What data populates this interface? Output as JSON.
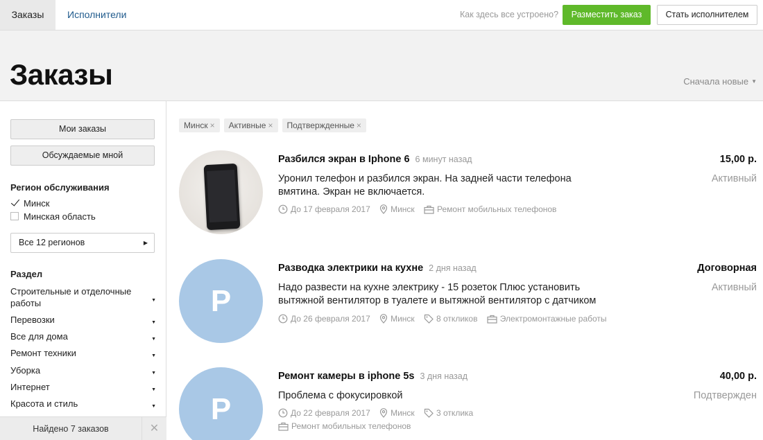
{
  "topbar": {
    "tab_orders": "Заказы",
    "tab_performers": "Исполнители",
    "how_link": "Как здесь все устроено?",
    "post_order": "Разместить заказ",
    "become_performer": "Стать исполнителем"
  },
  "header": {
    "title": "Заказы",
    "sort": "Сначала новые"
  },
  "sidebar": {
    "my_orders": "Мои заказы",
    "discussed": "Обсуждаемые мной",
    "region_heading": "Регион обслуживания",
    "regions": [
      {
        "label": "Минск",
        "checked": true
      },
      {
        "label": "Минская область",
        "checked": false
      }
    ],
    "all_regions": "Все 12 регионов",
    "section_heading": "Раздел",
    "categories": [
      "Строительные и отделочные работы",
      "Перевозки",
      "Все для дома",
      "Ремонт техники",
      "Уборка",
      "Интернет",
      "Красота и стиль"
    ],
    "found": "Найдено 7 заказов"
  },
  "filters": [
    "Минск",
    "Активные",
    "Подтвержденные"
  ],
  "orders": [
    {
      "title": "Разбился экран в Iphone 6",
      "time": "6 минут назад",
      "description": "Уронил телефон и разбился экран. На задней части телефона вмятина. Экран не включается.",
      "deadline": "До 17 февраля 2017",
      "city": "Минск",
      "category": "Ремонт мобильных телефонов",
      "price": "15,00 р.",
      "status": "Активный"
    },
    {
      "title": "Разводка электрики на кухне",
      "time": "2 дня назад",
      "avatar_letter": "Р",
      "description": "Надо развести на кухне электрику - 15 розеток Плюс установить вытяжной вентилятор в туалете и вытяжной вентилятор с датчиком",
      "deadline": "До 26 февраля 2017",
      "city": "Минск",
      "responses": "8 откликов",
      "category": "Электромонтажные работы",
      "price": "Договорная",
      "status": "Активный"
    },
    {
      "title": "Ремонт камеры в iphone 5s",
      "time": "3 дня назад",
      "avatar_letter": "Р",
      "description": "Проблема с фокусировкой",
      "deadline": "До 22 февраля 2017",
      "city": "Минск",
      "responses": "3 отклика",
      "category": "Ремонт мобильных телефонов",
      "price": "40,00 р.",
      "status": "Подтвержден"
    }
  ],
  "colors": {
    "accent_green": "#5fb92a",
    "link_blue": "#1f5a8c",
    "avatar_blue": "#a9c8e6"
  }
}
